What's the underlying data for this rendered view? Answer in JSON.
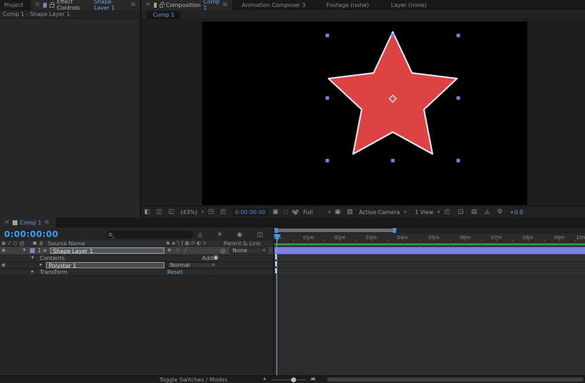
{
  "colors": {
    "accent_blue": "#6aa5e8",
    "timecode_blue": "#3c9df2",
    "star_fill": "#dc4343",
    "star_stroke": "#e8e2f0",
    "handle_blue": "#8181e8",
    "layer_bar": "#7b82e0",
    "cache_green": "#2fa02f",
    "label_swatch_blue": "#7986cb",
    "tab_swatch_khaki": "#a8a488"
  },
  "icons": {
    "close": "×",
    "menu": "≡",
    "caret": "▾",
    "eye": "◉",
    "audio": "♪",
    "solo": "○",
    "label_tag": "▪",
    "hash": "#",
    "star_layer": "★",
    "twirl_open": "▼",
    "twirl_closed": "▶",
    "pickwhip": "@",
    "add_circle": "◉",
    "layer_switch_glyphs": "♣ ◇ ╱",
    "header_switch_glyphs": "♣ ◈ ╲ ƒ ▦ ∅ ◐ ☼",
    "viewer_left_glyphs": "◧ ◫ ◱",
    "grid_glyphs": "◳ ◰",
    "camera": "▣",
    "snapshot_ghost": "◻",
    "roi_glyphs": "▣ ▨",
    "right_tool_glyphs": "◰ ◲ ▤ ◬ ⚙",
    "panel_icon_glyphs": "◬ ✳ ◉ ◫ ◔ ▢",
    "mountain_small": "▲",
    "mountain_large": "▲▲",
    "ibeam": "I"
  },
  "effect_controls": {
    "tab_project": "Project",
    "tab_label": "Effect Controls",
    "tab_target": "Shape Layer 1",
    "breadcrumb": "Comp 1 - Shape Layer 1"
  },
  "viewer": {
    "tab_composition": "Composition",
    "tab_composition_target": "Comp 1",
    "tab_animation_composer": "Animation Composer 3",
    "tab_footage": "Footage  (none)",
    "tab_layer": "Layer  (none)",
    "subtab": "Comp 1",
    "toolbar": {
      "magnification": "(43%)",
      "timecode": "0:00:00:00",
      "resolution": "Full",
      "camera_view": "Active Camera",
      "view_layout": "1 View",
      "exposure": "+0.0"
    }
  },
  "timeline": {
    "tab": "Comp 1",
    "timecode": "0:00:00:00",
    "columns": {
      "source_name": "Source Name",
      "parent_link": "Parent & Link"
    },
    "layer": {
      "number": "1",
      "name": "Shape Layer 1",
      "parent": "None"
    },
    "contents_row": {
      "label": "Contents",
      "add_label": "Add:"
    },
    "polystar_row": {
      "label": "Polystar 1",
      "blend_mode": "Normal"
    },
    "transform_row": {
      "label": "Transform",
      "action": "Reset"
    },
    "ruler_labels": [
      "0m",
      "01m",
      "02m",
      "03m",
      "04m",
      "05m",
      "06m",
      "07m",
      "08m",
      "09m",
      "10m"
    ]
  },
  "footer": {
    "toggle_label": "Toggle Switches / Modes"
  }
}
